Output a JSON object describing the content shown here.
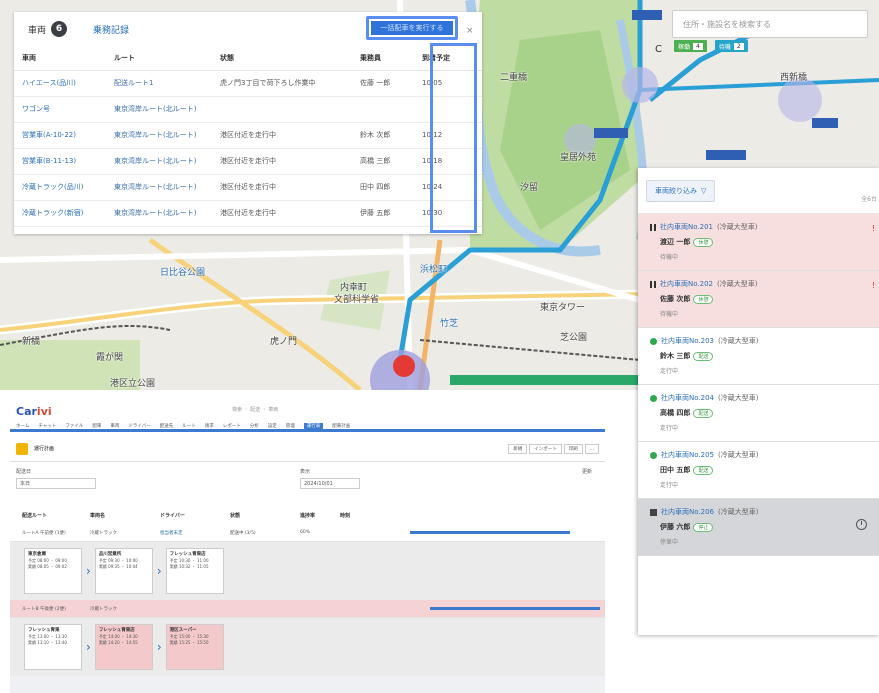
{
  "map": {
    "labels": [
      "二重橋",
      "皇居外苑",
      "日比谷公園",
      "内幸町",
      "文部科学省",
      "虎ノ門",
      "霞が関",
      "新橋",
      "港区立公園",
      "東京タワー",
      "芝公園",
      "浜松町",
      "竹芝",
      "汐留",
      "西新橋"
    ]
  },
  "table_panel": {
    "tab_active": "車両",
    "tab_active_count": "6",
    "tab_link": "乗務記録",
    "action_button": "一括配車を実行する",
    "close": "×",
    "columns": [
      "車両",
      "ルート",
      "状態",
      "乗務員",
      "到着予定"
    ],
    "rows": [
      [
        "ハイエース(品川)",
        "配送ルート1",
        "虎ノ門3丁目で荷下ろし作業中",
        "佐藤 一郎",
        "10:05"
      ],
      [
        "ワゴン号",
        "東京湾岸ルート(北ルート)",
        "",
        "",
        ""
      ],
      [
        "営業車(A-10-22)",
        "東京湾岸ルート(北ルート)",
        "港区付近を走行中",
        "鈴木 次郎",
        "10:12"
      ],
      [
        "営業車(B-11-13)",
        "東京湾岸ルート(北ルート)",
        "港区付近を走行中",
        "高橋 三郎",
        "10:18"
      ],
      [
        "冷蔵トラック(品川)",
        "東京湾岸ルート(北ルート)",
        "港区付近を走行中",
        "田中 四郎",
        "10:24"
      ],
      [
        "冷蔵トラック(新宿)",
        "東京湾岸ルート(北ルート)",
        "港区付近を走行中",
        "伊藤 五郎",
        "10:30"
      ]
    ]
  },
  "search": {
    "placeholder": "住所・施設名を検索する"
  },
  "filters": [
    {
      "label": "稼働",
      "count": "4"
    },
    {
      "label": "待機",
      "count": "2"
    }
  ],
  "vehicle_panel": {
    "filter_button": "車両絞り込み",
    "hint": "全6台",
    "items": [
      {
        "name": "社内車両No.201",
        "sub": "(冷蔵大型車)",
        "driver": "渡辺 一郎",
        "tag": "休憩",
        "note": "待機中",
        "status": "pause",
        "bg": "pink",
        "right": "!"
      },
      {
        "name": "社内車両No.202",
        "sub": "(冷蔵大型車)",
        "driver": "佐藤 次郎",
        "tag": "休憩",
        "note": "待機中",
        "status": "pause",
        "bg": "pink",
        "right": "!"
      },
      {
        "name": "社内車両No.203",
        "sub": "(冷蔵大型車)",
        "driver": "鈴木 三郎",
        "tag": "配送",
        "note": "走行中",
        "status": "green",
        "bg": "white",
        "right": ""
      },
      {
        "name": "社内車両No.204",
        "sub": "(冷蔵大型車)",
        "driver": "高橋 四郎",
        "tag": "配送",
        "note": "走行中",
        "status": "green",
        "bg": "white",
        "right": ""
      },
      {
        "name": "社内車両No.205",
        "sub": "(冷蔵大型車)",
        "driver": "田中 五郎",
        "tag": "配送",
        "note": "走行中",
        "status": "green",
        "bg": "white",
        "right": ""
      },
      {
        "name": "社内車両No.206",
        "sub": "(冷蔵大型車)",
        "driver": "伊藤 六郎",
        "tag": "停止",
        "note": "停車中",
        "status": "stop",
        "bg": "grey",
        "right": ""
      }
    ]
  },
  "scheduler": {
    "logo_a": "Car",
    "logo_b": "ivi",
    "search_text": "検索 ・ 配送 ・ 車両",
    "nav": [
      "ホーム",
      "チャット",
      "ファイル",
      "配車",
      "車両",
      "ドライバー",
      "配送先",
      "ルート",
      "請求",
      "レポート",
      "分析",
      "設定",
      "管理",
      "運行表",
      "配車計画"
    ],
    "nav_active": "運行表",
    "title": "運行計画",
    "buttons": [
      "新規",
      "インポート",
      "印刷",
      "..."
    ],
    "filter_label_a": "配送日",
    "filter_value_a": "本日",
    "filter_label_b": "表示",
    "filter_value_b": "2024/10/01",
    "filter_label_c": "更新",
    "headers": [
      "配送ルート",
      "車両名",
      "ドライバー",
      "状態",
      "進捗率",
      "時刻"
    ],
    "rows": [
      {
        "cells": [
          "ルートA 午前便 (1便)",
          "冷蔵トラック",
          "担当者未定",
          "配送中 (3/5)",
          "60%"
        ],
        "style": "white"
      },
      {
        "cells": [
          "ルートB 午後便 (2便)",
          "冷蔵トラック",
          "",
          "",
          ""
        ],
        "style": "pink"
      }
    ],
    "cards_a": [
      {
        "title": "東京倉庫",
        "l1": "予定 08:00 ・ 09:00",
        "l2": "実績 08:05 ・ 09:02",
        "style": "white"
      },
      {
        "title": "品川営業所",
        "l1": "予定 09:30 ・ 10:00",
        "l2": "実績 09:35 ・ 10:04",
        "style": "white"
      },
      {
        "title": "フレッシュ青果店",
        "l1": "予定 10:30 ・ 11:00",
        "l2": "実績 10:32 ・ 11:05",
        "style": "white"
      }
    ],
    "cards_b": [
      {
        "title": "フレッシュ青果",
        "l1": "予定 13:00 ・ 13:30",
        "l2": "実績 13:10 ・ 13:40",
        "style": "white"
      },
      {
        "title": "フレッシュ青果店",
        "l1": "予定 14:00 ・ 14:30",
        "l2": "実績 14:20 ・ 14:55",
        "style": "pink"
      },
      {
        "title": "港区スーパー",
        "l1": "予定 15:00 ・ 15:30",
        "l2": "実績 15:25 ・ 15:50",
        "style": "pink"
      }
    ],
    "arrow": "›"
  }
}
